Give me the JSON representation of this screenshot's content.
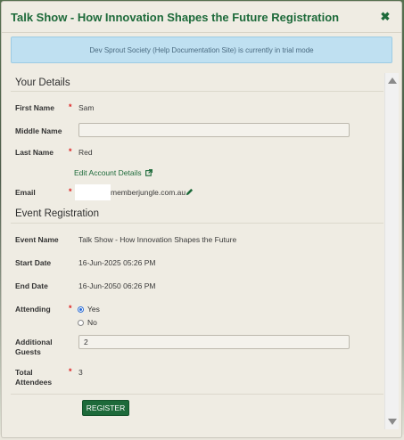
{
  "modal": {
    "title": "Talk Show - How Innovation Shapes the Future Registration",
    "close_symbol": "✖",
    "trial_banner": "Dev Sprout Society (Help Documentation Site) is currently in trial mode"
  },
  "your_details": {
    "heading": "Your Details",
    "first_name": {
      "label": "First Name",
      "required": "*",
      "value": "Sam"
    },
    "middle_name": {
      "label": "Middle Name",
      "value": ""
    },
    "last_name": {
      "label": "Last Name",
      "required": "*",
      "value": "Red"
    },
    "edit_account_link": "Edit Account Details",
    "email": {
      "label": "Email",
      "required": "*",
      "value_visible": "memberjungle.com.au"
    }
  },
  "event_registration": {
    "heading": "Event Registration",
    "event_name": {
      "label": "Event Name",
      "value": "Talk Show - How Innovation Shapes the Future"
    },
    "start_date": {
      "label": "Start Date",
      "value": "16-Jun-2025 05:26 PM"
    },
    "end_date": {
      "label": "End Date",
      "value": "16-Jun-2050 06:26 PM"
    },
    "attending": {
      "label": "Attending",
      "required": "*",
      "options": [
        "Yes",
        "No"
      ],
      "selected": "Yes"
    },
    "additional_guests": {
      "label_line1": "Additional",
      "label_line2": "Guests",
      "value": "2"
    },
    "total_attendees": {
      "label_line1": "Total",
      "label_line2": "Attendees",
      "required": "*",
      "value": "3"
    },
    "register_button": "REGISTER"
  },
  "colors": {
    "accent": "#1d6a3a",
    "required": "#dd2222",
    "banner_bg": "#bfe0f1"
  },
  "icons": {
    "close": "close-icon",
    "external_link": "external-link-icon",
    "pencil": "pencil-icon"
  }
}
